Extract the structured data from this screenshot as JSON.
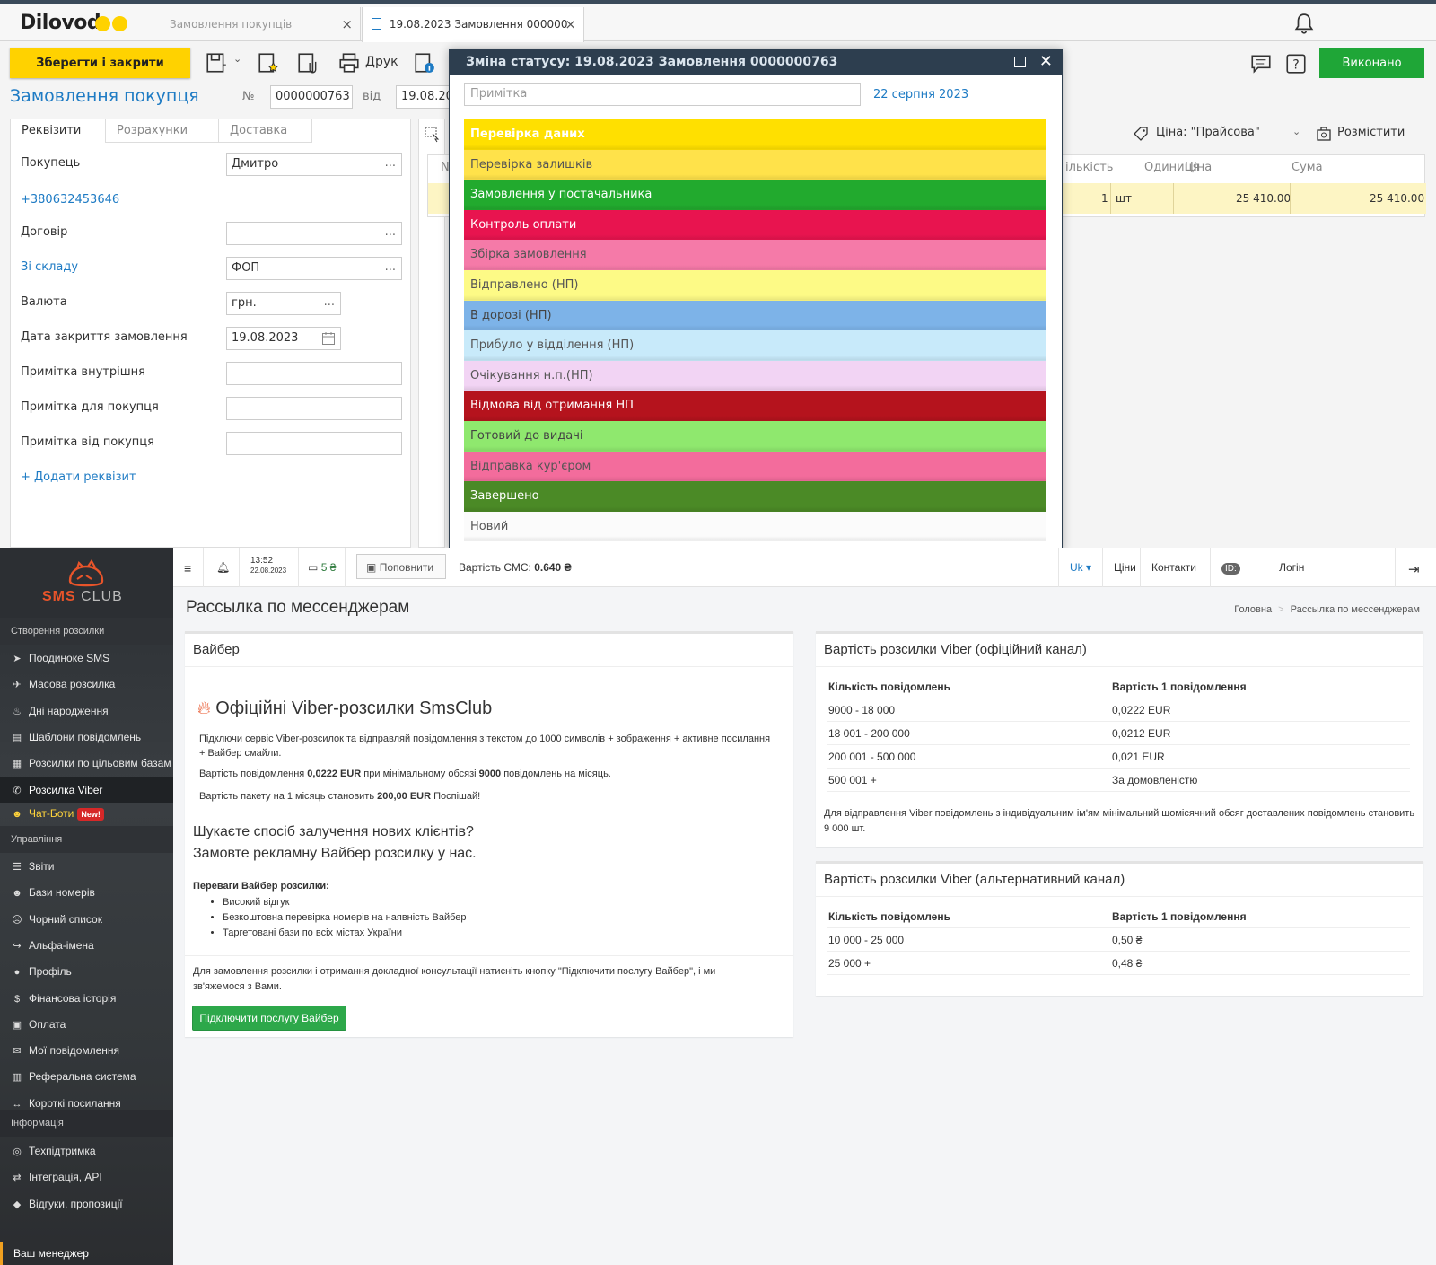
{
  "dilovod": {
    "logo": "Dilovod",
    "tabs": [
      {
        "label": "Замовлення покупців"
      },
      {
        "label": "19.08.2023 Замовлення 000000"
      }
    ],
    "toolbar": {
      "save_close": "Зберегти і закрити",
      "print": "Друк",
      "done": "Виконано"
    },
    "doc": {
      "title": "Замовлення покупця",
      "num_label": "№",
      "num": "0000000763",
      "from_label": "від",
      "date": "19.08.2023"
    },
    "form_tabs": [
      "Реквізити",
      "Розрахунки",
      "Доставка"
    ],
    "form": {
      "buyer_label": "Покупець",
      "buyer": "Дмитро",
      "phone": "+380632453646",
      "contract_label": "Договір",
      "contract": "",
      "warehouse_label": "Зі складу",
      "warehouse": "ФОП",
      "currency_label": "Валюта",
      "currency": "грн.",
      "close_date_label": "Дата закриття замовлення",
      "close_date": "19.08.2023",
      "note_internal_label": "Примітка внутрішня",
      "note_buyer_label": "Примітка для покупця",
      "note_from_buyer_label": "Примітка від покупця",
      "add_field": "+ Додати реквізит",
      "dots": "..."
    },
    "right": {
      "price_type": "Ціна: \"Прайсова\"",
      "place": "Розмістити"
    },
    "table": {
      "headers": [
        "N",
        "ількість",
        "Одиниця",
        "Ціна",
        "Сума"
      ],
      "row": {
        "qty": "1",
        "unit": "шт",
        "price": "25 410.00",
        "sum": "25 410.00"
      }
    },
    "modal": {
      "title": "Зміна статусу: 19.08.2023 Замовлення 0000000763",
      "note_placeholder": "Примітка",
      "date": "22 серпня 2023",
      "statuses": [
        {
          "label": "Перевірка даних",
          "bg": "#ffe000",
          "color": "#ffffff",
          "bold": true
        },
        {
          "label": "Перевірка залишків",
          "bg": "#ffe24a",
          "color": "#555555",
          "bold": false
        },
        {
          "label": "Замовлення у постачальника",
          "bg": "#22aa2e",
          "color": "#ffffff",
          "bold": false
        },
        {
          "label": "Контроль оплати",
          "bg": "#e8144f",
          "color": "#ffffff",
          "bold": false
        },
        {
          "label": "Збірка замовлення",
          "bg": "#f57aa8",
          "color": "#555555",
          "bold": false
        },
        {
          "label": "Відправлено (НП)",
          "bg": "#fdfa86",
          "color": "#555555",
          "bold": false
        },
        {
          "label": "В дорозі (НП)",
          "bg": "#7db3e8",
          "color": "#444444",
          "bold": false
        },
        {
          "label": "Прибуло у відділення (НП)",
          "bg": "#c8eafa",
          "color": "#555555",
          "bold": false
        },
        {
          "label": "Очікування н.п.(НП)",
          "bg": "#f2d4f4",
          "color": "#555555",
          "bold": false
        },
        {
          "label": "Відмова від отримання НП",
          "bg": "#b5131d",
          "color": "#ffffff",
          "bold": false
        },
        {
          "label": "Готовий до видачі",
          "bg": "#8fe86e",
          "color": "#444444",
          "bold": false
        },
        {
          "label": "Відправка кур'єром",
          "bg": "#f36c9c",
          "color": "#555555",
          "bold": false
        },
        {
          "label": "Завершено",
          "bg": "#4b8a26",
          "color": "#ffffff",
          "bold": false
        },
        {
          "label": "Новий",
          "bg": "#fbfbfb",
          "color": "#555555",
          "bold": false
        }
      ]
    }
  },
  "smsclub": {
    "logo": {
      "sms": "SMS",
      "club": "CLUB"
    },
    "sidebar": {
      "section_create": "Створення розсилки",
      "create_items": [
        {
          "label": "Поодиноке SMS",
          "icon": "paper-plane-icon",
          "glyph": "➤"
        },
        {
          "label": "Масова розсилка",
          "icon": "rocket-icon",
          "glyph": "✈"
        },
        {
          "label": "Дні народження",
          "icon": "cake-icon",
          "glyph": "♨"
        },
        {
          "label": "Шаблони повідомлень",
          "icon": "file-icon",
          "glyph": "▤"
        },
        {
          "label": "Розсилки по цільовим базам",
          "icon": "table-icon",
          "glyph": "▦"
        },
        {
          "label": "Розсилка Viber",
          "icon": "viber-icon",
          "glyph": "✆"
        }
      ],
      "chatbots": "Чат-Боти",
      "new_badge": "New!",
      "section_manage": "Управління",
      "manage_items": [
        {
          "label": "Звіти",
          "icon": "list-icon",
          "glyph": "☰"
        },
        {
          "label": "Бази номерів",
          "icon": "users-icon",
          "glyph": "☻"
        },
        {
          "label": "Чорний список",
          "icon": "user-block-icon",
          "glyph": "☹"
        },
        {
          "label": "Альфа-імена",
          "icon": "share-icon",
          "glyph": "↪"
        },
        {
          "label": "Профіль",
          "icon": "user-icon",
          "glyph": "●"
        },
        {
          "label": "Фінансова історія",
          "icon": "dollar-icon",
          "glyph": "$"
        },
        {
          "label": "Оплата",
          "icon": "money-icon",
          "glyph": "▣"
        },
        {
          "label": "Мої повідомлення",
          "icon": "envelope-icon",
          "glyph": "✉"
        },
        {
          "label": "Реферальна система",
          "icon": "chart-icon",
          "glyph": "▥"
        },
        {
          "label": "Короткі посилання",
          "icon": "link-icon",
          "glyph": "↔"
        }
      ],
      "section_info": "Інформація",
      "info_items": [
        {
          "label": "Техпідтримка",
          "icon": "lifebuoy-icon",
          "glyph": "◎"
        },
        {
          "label": "Інтеграція, API",
          "icon": "exchange-icon",
          "glyph": "⇄"
        },
        {
          "label": "Відгуки, пропозиції",
          "icon": "comment-icon",
          "glyph": "◆"
        }
      ],
      "manager": "Ваш менеджер"
    },
    "topbar": {
      "time": "13:52",
      "date": "22.08.2023",
      "balance": "5 ₴",
      "topup": "Поповнити",
      "sms_cost_label": "Вартість СМС:",
      "sms_cost": "0.640 ₴",
      "lang": "Uk ▾",
      "prices": "Ціни",
      "contacts": "Контакти",
      "id_label": "ID:",
      "login": "Логін"
    },
    "page_title": "Рассылка по мессенджерам",
    "breadcrumb": {
      "home": "Головна",
      "sep": ">",
      "current": "Рассылка по мессенджерам"
    },
    "viber_card": {
      "title": "Вайбер",
      "heading": "Офіційні Viber-розсилки SmsClub",
      "p1": "Підключи сервіс Viber-розсилок та відправляй повідомлення з текстом до 1000 символів + зображення + активне посилання + Вайбер смайли.",
      "p2_a": "Вартість повідомлення ",
      "p2_b": "0,0222 EUR",
      "p2_c": " при мінімальному обсязі ",
      "p2_d": "9000",
      "p2_e": " повідомлень на місяць.",
      "p3_a": "Вартість пакету на 1 місяць становить ",
      "p3_b": "200,00 EUR",
      "p3_c": " Поспішай!",
      "ad_line1": "Шукаєте спосіб залучення нових клієнтів?",
      "ad_line2": "Замовте рекламну Вайбер розсилку у нас.",
      "benefits_title": "Переваги Вайбер розсилки:",
      "benefits": [
        "Високий відгук",
        "Безкоштовна перевірка номерів на наявність Вайбер",
        "Таргетовані бази по всіх містах України"
      ],
      "footer": "Для замовлення розсилки і отримання докладної консультації натисніть кнопку \"Підключити послугу Вайбер\", і ми зв'яжемося з Вами.",
      "button": "Підключити послугу Вайбер"
    },
    "official_card": {
      "title": "Вартість розсилки Viber (офіційний канал)",
      "col1": "Кількість повідомлень",
      "col2": "Вартість 1 повідомлення",
      "rows": [
        {
          "qty": "9000 - 18 000",
          "price": "0,0222 EUR"
        },
        {
          "qty": "18 001 - 200 000",
          "price": "0,0212 EUR"
        },
        {
          "qty": "200 001 - 500 000",
          "price": "0,021 EUR"
        },
        {
          "qty": "500 001 +",
          "price": "За домовленістю"
        }
      ],
      "note": "Для відправлення Viber повідомлень з індивідуальним ім'ям мінімальний щомісячний обсяг доставлених повідомлень становить 9 000 шт."
    },
    "alt_card": {
      "title": "Вартість розсилки Viber (альтернативний канал)",
      "col1": "Кількість повідомлень",
      "col2": "Вартість 1 повідомлення",
      "rows": [
        {
          "qty": "10 000 - 25 000",
          "price": "0,50 ₴"
        },
        {
          "qty": "25 000 +",
          "price": "0,48 ₴"
        }
      ]
    }
  }
}
